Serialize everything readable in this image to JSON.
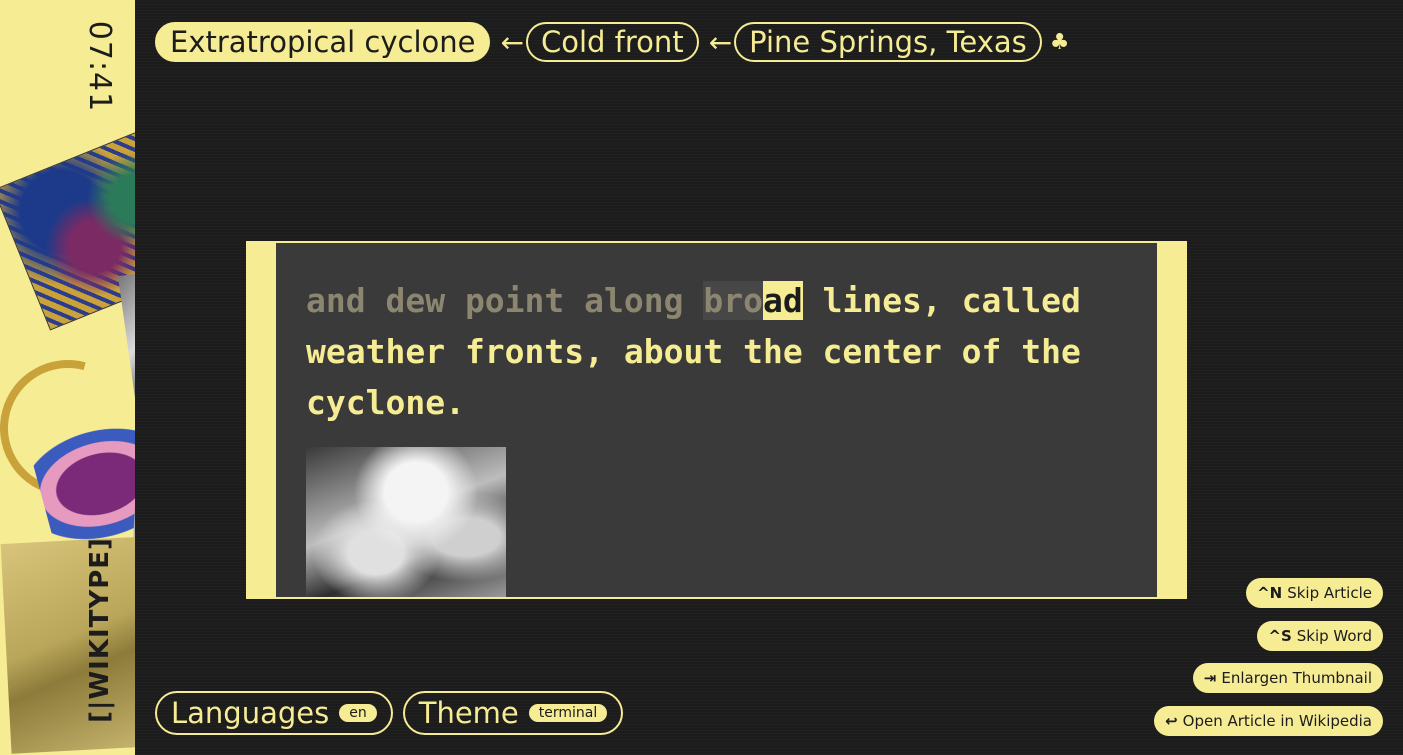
{
  "clock": "07:41",
  "logo": "[|WIKITYPE]",
  "breadcrumbs": {
    "current": "Extratropical cyclone",
    "items": [
      "Cold front",
      "Pine Springs, Texas"
    ],
    "arrow": "←",
    "end_icon": "♣"
  },
  "typing": {
    "typed": "and dew point along ",
    "word_typed": "bro",
    "cursor": "ad",
    "rest_line1": " lines, called",
    "line2": "weather fronts, about the center of the",
    "line3": "cyclone."
  },
  "footer": {
    "languages_label": "Languages",
    "languages_value": "en",
    "theme_label": "Theme",
    "theme_value": "terminal"
  },
  "shortcuts": [
    {
      "key": "^N",
      "label": "Skip Article"
    },
    {
      "key": "^S",
      "label": "Skip Word"
    },
    {
      "key": "⇥",
      "label": "Enlargen Thumbnail"
    },
    {
      "key": "↩",
      "label": "Open Article in Wikipedia"
    }
  ],
  "colors": {
    "accent": "#f6ec94",
    "background": "#1c1c1c",
    "panel": "#3a3a3a"
  }
}
